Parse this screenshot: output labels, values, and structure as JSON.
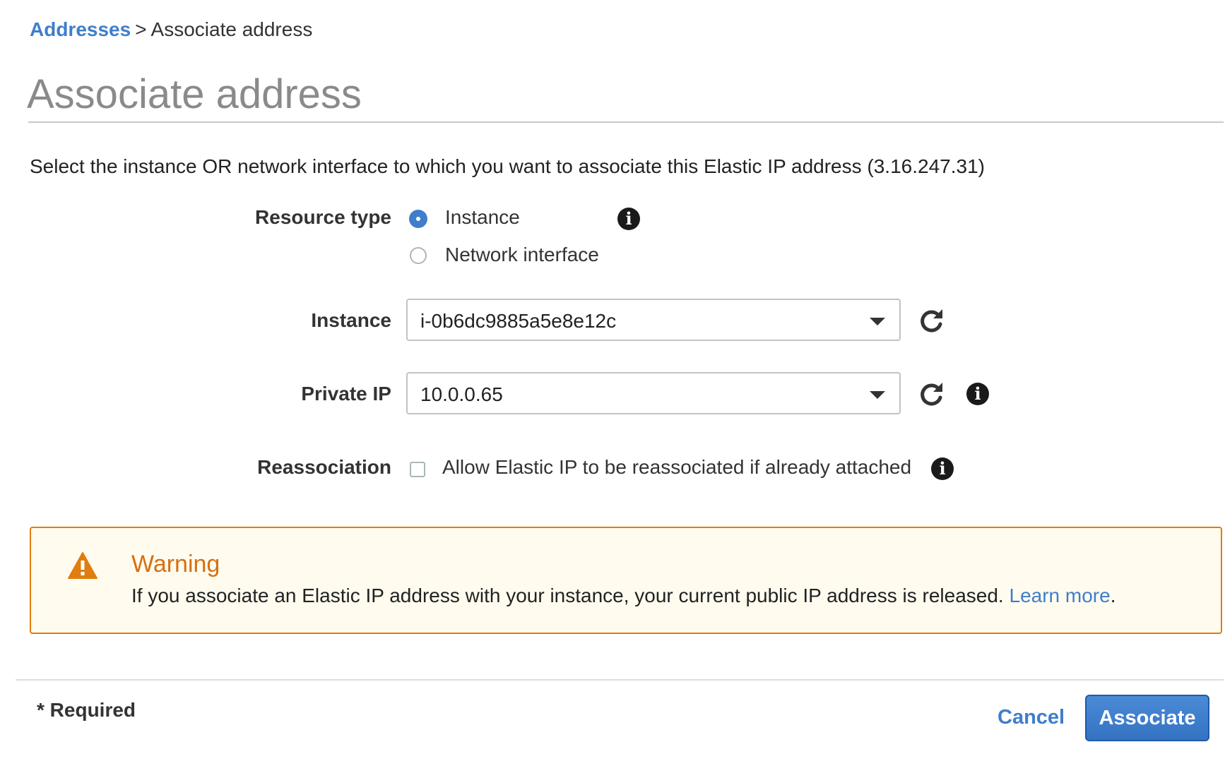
{
  "breadcrumb": {
    "parent": "Addresses",
    "separator": ">",
    "current": "Associate address"
  },
  "page": {
    "title": "Associate address",
    "description": "Select the instance OR network interface to which you want to associate this Elastic IP address (3.16.247.31)"
  },
  "form": {
    "resource_type": {
      "label": "Resource type",
      "options": [
        {
          "label": "Instance",
          "selected": true
        },
        {
          "label": "Network interface",
          "selected": false
        }
      ]
    },
    "instance": {
      "label": "Instance",
      "value": "i-0b6dc9885a5e8e12c"
    },
    "private_ip": {
      "label": "Private IP",
      "value": "10.0.0.65"
    },
    "reassociation": {
      "label": "Reassociation",
      "checkbox_label": "Allow Elastic IP to be reassociated if already attached",
      "checked": false
    }
  },
  "warning": {
    "title": "Warning",
    "message": "If you associate an Elastic IP address with your instance, your current public IP address is released.",
    "link_text": "Learn more",
    "trailing": "."
  },
  "footer": {
    "required_note": "* Required",
    "cancel_label": "Cancel",
    "associate_label": "Associate"
  },
  "colors": {
    "link": "#3f7ecb",
    "warning_accent": "#e07d10",
    "primary_button": "#3573c2"
  },
  "icons": [
    "info-icon",
    "refresh-icon",
    "caret-down-icon",
    "warning-triangle-icon"
  ]
}
